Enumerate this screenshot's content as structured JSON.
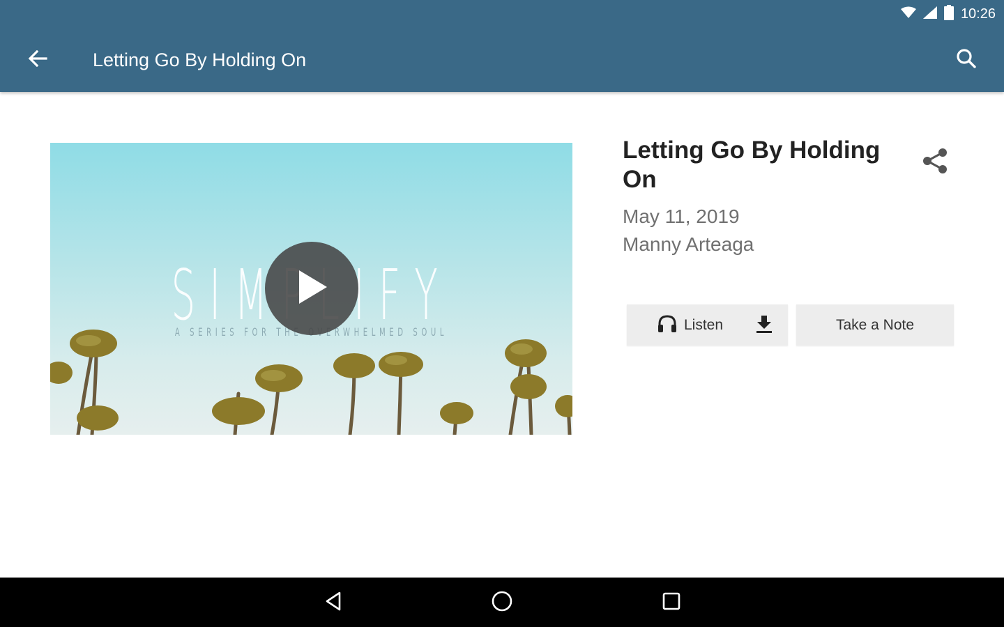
{
  "status_bar": {
    "time": "10:26",
    "icons": [
      "wifi-icon",
      "cell-signal-icon",
      "battery-icon"
    ]
  },
  "toolbar": {
    "title": "Letting Go By Holding On",
    "back_icon": "arrow-left-icon",
    "search_icon": "search-icon",
    "background_color": "#3a6987"
  },
  "video": {
    "overlay_title": "SIMPLIFY",
    "overlay_subtitle": "A SERIES FOR THE OVERWHELMED SOUL",
    "play_icon": "play-icon"
  },
  "sermon": {
    "title": "Letting Go By Holding On",
    "date": "May 11, 2019",
    "speaker": "Manny Arteaga",
    "share_icon": "share-icon"
  },
  "actions": {
    "listen_label": "Listen",
    "listen_icon": "headphones-icon",
    "download_icon": "download-icon",
    "note_label": "Take a Note"
  },
  "navigation": {
    "buttons": [
      "back-triangle-icon",
      "home-circle-icon",
      "recents-square-icon"
    ]
  }
}
